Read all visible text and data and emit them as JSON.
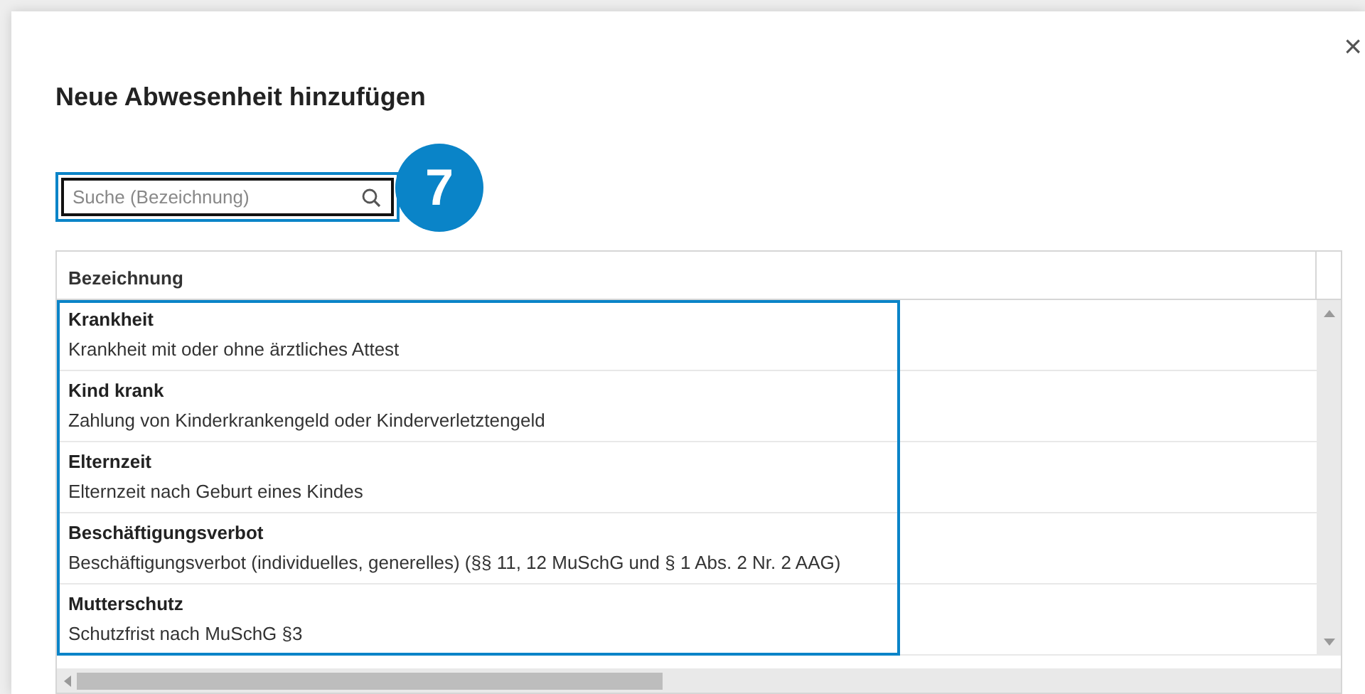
{
  "dialog": {
    "title": "Neue Abwesenheit hinzufügen",
    "close": "×"
  },
  "search": {
    "placeholder": "Suche (Bezeichnung)",
    "highlighted": true
  },
  "step_badge": "7",
  "table": {
    "columns": [
      "Bezeichnung"
    ],
    "highlighted": true,
    "rows": [
      {
        "title": "Krankheit",
        "description": "Krankheit mit oder ohne ärztliches Attest"
      },
      {
        "title": "Kind krank",
        "description": "Zahlung von Kinderkrankengeld oder Kinderverletztengeld"
      },
      {
        "title": "Elternzeit",
        "description": "Elternzeit nach Geburt eines Kindes"
      },
      {
        "title": "Beschäftigungsverbot",
        "description": "Beschäftigungsverbot (individuelles, generelles) (§§ 11, 12 MuSchG und § 1 Abs. 2 Nr. 2 AAG)"
      },
      {
        "title": "Mutterschutz",
        "description": "Schutzfrist nach MuSchG §3"
      }
    ]
  }
}
